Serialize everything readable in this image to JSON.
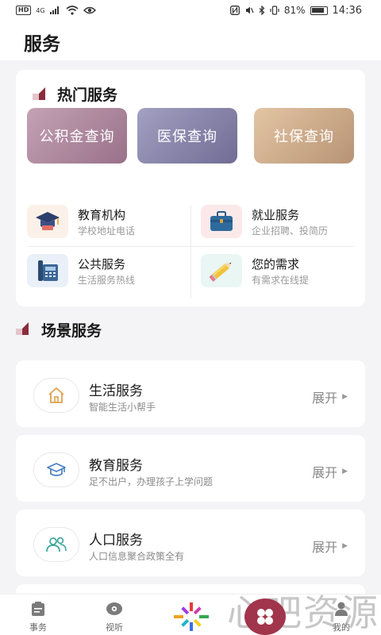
{
  "status_bar": {
    "hd": "HD",
    "network": "4G",
    "battery": "81%",
    "time": "14:36"
  },
  "header": {
    "title": "服务"
  },
  "hot_services": {
    "title": "热门服务",
    "buttons": [
      {
        "label": "公积金查询"
      },
      {
        "label": "医保查询"
      },
      {
        "label": "社保查询"
      }
    ],
    "grid": [
      {
        "name": "教育机构",
        "desc": "学校地址电话",
        "icon": "graduation-cap-icon"
      },
      {
        "name": "就业服务",
        "desc": "企业招聘、投简历",
        "icon": "briefcase-icon"
      },
      {
        "name": "公共服务",
        "desc": "生活服务热线",
        "icon": "telephone-icon"
      },
      {
        "name": "您的需求",
        "desc": "有需求在线提",
        "icon": "pencil-icon"
      }
    ]
  },
  "scene_services": {
    "title": "场景服务",
    "items": [
      {
        "name": "生活服务",
        "desc": "智能生活小帮手",
        "action": "展开",
        "icon": "home-icon",
        "icon_color": "#e0a24c"
      },
      {
        "name": "教育服务",
        "desc": "足不出户，办理孩子上学问题",
        "action": "展开",
        "icon": "mortarboard-icon",
        "icon_color": "#4a7fc1"
      },
      {
        "name": "人口服务",
        "desc": "人口信息聚合政策全有",
        "action": "展开",
        "icon": "people-icon",
        "icon_color": "#3aa59a"
      }
    ]
  },
  "tabbar": {
    "tabs": [
      {
        "label": "事务",
        "icon": "clipboard-icon"
      },
      {
        "label": "视听",
        "icon": "play-disc-icon"
      },
      {
        "label": "",
        "icon": "logo-burst-icon"
      },
      {
        "label": "",
        "icon": "grid-clover-icon"
      },
      {
        "label": "我的",
        "icon": "user-icon"
      }
    ]
  },
  "watermark": {
    "text": "心吧资源"
  },
  "colors": {
    "accent": "#8a2d3e",
    "fab": "#a0354c",
    "background": "#f4f4f6"
  }
}
